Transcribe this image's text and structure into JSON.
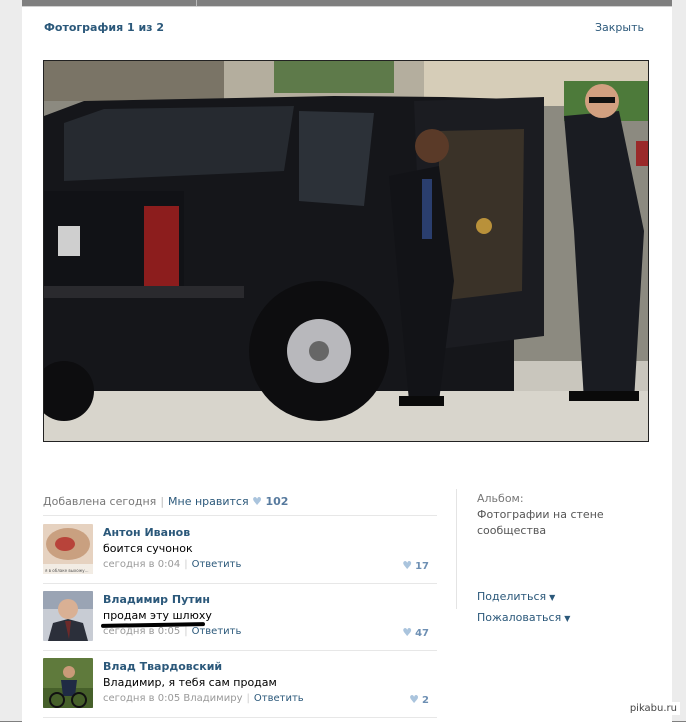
{
  "viewer": {
    "title": "Фотография 1 из 2",
    "close_label": "Закрыть"
  },
  "info": {
    "added": "Добавлена сегодня",
    "like_label": "Мне нравится",
    "like_count": "102"
  },
  "comments": [
    {
      "author": "Антон Иванов",
      "text": "боится сучонок",
      "time": "сегодня в 0:04",
      "addressee": "",
      "reply": "Ответить",
      "likes": "17",
      "avatar_caption": "я в облаке выхожу..."
    },
    {
      "author": "Владимир Путин",
      "text": "продам эту шлюху",
      "time": "сегодня в 0:05",
      "addressee": "",
      "reply": "Ответить",
      "likes": "47"
    },
    {
      "author": "Влад Твардовский",
      "text": "Владимир, я тебя сам продам",
      "time": "сегодня в 0:05",
      "addressee": "Владимиру",
      "reply": "Ответить",
      "likes": "2"
    }
  ],
  "sidebar": {
    "album_label": "Альбом:",
    "album_name": "Фотографии на стене сообщества",
    "share_label": "Поделиться",
    "report_label": "Пожаловаться"
  },
  "watermark": "pikabu.ru",
  "colors": {
    "link": "#2b587a",
    "muted": "#777777",
    "overlay": "#7f7f7f",
    "like": "#aac4dd"
  },
  "icons": {
    "like": "heart-icon",
    "dropdown": "triangle-down-icon"
  }
}
